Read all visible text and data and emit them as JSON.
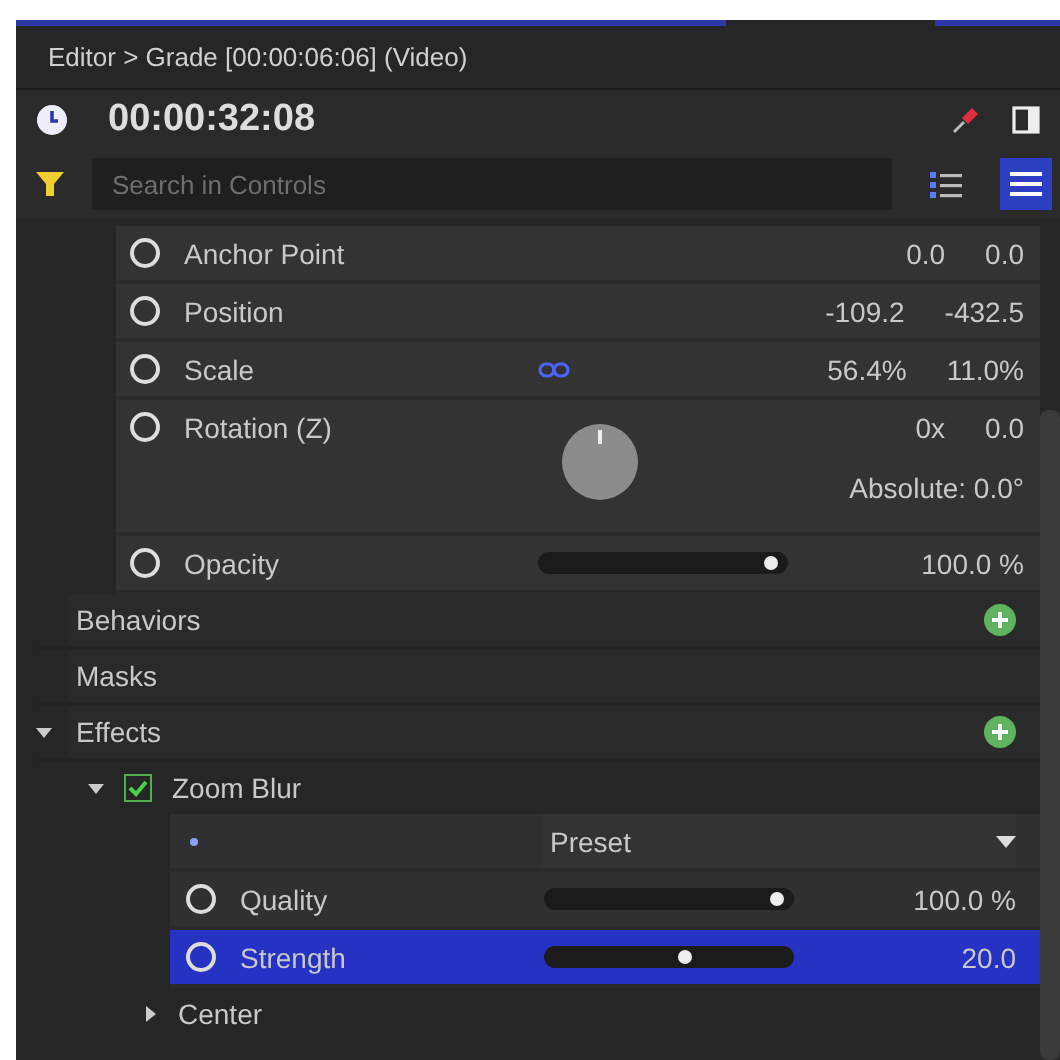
{
  "header": {
    "breadcrumb": "Editor > Grade [00:00:06:06] (Video)",
    "timecode": "00:00:32:08",
    "search": {
      "placeholder": "Search in Controls"
    },
    "view_buttons": [
      {
        "selected": false
      },
      {
        "selected": true
      }
    ]
  },
  "transform": [
    {
      "kind": "pair",
      "label": "Anchor Point",
      "values": [
        "0.0",
        "0.0"
      ]
    },
    {
      "kind": "pair",
      "label": "Position",
      "values": [
        "-109.2",
        "-432.5"
      ]
    },
    {
      "kind": "linked",
      "label": "Scale",
      "values": [
        "56.4%",
        "11.0%"
      ]
    },
    {
      "kind": "dial",
      "label": "Rotation (Z)",
      "values": [
        "0x",
        "0.0"
      ],
      "absolute": "Absolute: 0.0°"
    },
    {
      "kind": "slider",
      "label": "Opacity",
      "level": 0.95,
      "reading": "100.0 %"
    }
  ],
  "sections": [
    {
      "label": "Behaviors",
      "addable": true
    },
    {
      "label": "Masks",
      "addable": false
    },
    {
      "label": "Effects",
      "addable": true,
      "expanded": true
    }
  ],
  "effects": [
    {
      "label": "Zoom Blur",
      "enabled": true,
      "expanded": true,
      "preset": "Preset",
      "params": [
        {
          "label": "Quality",
          "level": 0.95,
          "reading": "100.0 %",
          "selected": false
        },
        {
          "label": "Strength",
          "level": 0.58,
          "reading": "20.0",
          "selected": true
        }
      ],
      "groups": [
        {
          "label": "Center",
          "expanded": false
        }
      ]
    }
  ]
}
